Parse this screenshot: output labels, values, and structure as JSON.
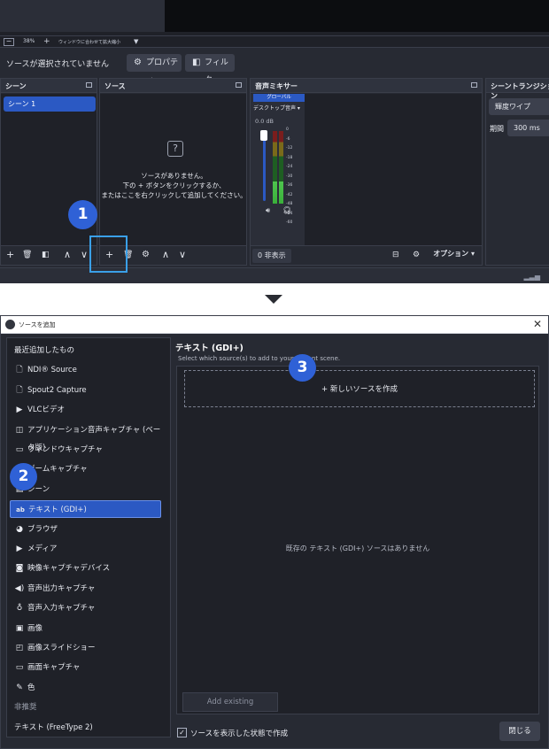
{
  "obs": {
    "zoom": {
      "minus": "−",
      "percent": "38%",
      "plus": "+",
      "fit_label": "ウィンドウに合わせて拡大縮小",
      "caret": "▼"
    },
    "context_bar": {
      "no_source": "ソースが選択されていません",
      "properties": "プロパティ",
      "filters": "フィルタ",
      "properties_icon": "gear-icon",
      "filters_icon": "filter-icon"
    },
    "docks": {
      "scenes": {
        "title": "シーン",
        "items": [
          "シーン 1"
        ]
      },
      "sources": {
        "title": "ソース",
        "empty_icon": "?",
        "empty_text": [
          "ソースがありません。",
          "下の + ボタンをクリックするか、",
          "またはここを右クリックして追加してください。"
        ]
      },
      "mixer": {
        "title": "音声ミキサー",
        "global_label": "グローバル",
        "device": "デスクトップ音声",
        "db": "0.0 dB",
        "ticks": [
          "0",
          "-6",
          "-12",
          "-18",
          "-24",
          "-30",
          "-36",
          "-42",
          "-48",
          "-54",
          "-60"
        ],
        "level": 0.3,
        "hidden_count": "0 非表示",
        "options": "オプション"
      },
      "transitions": {
        "title": "シーントランジション",
        "type": "輝度ワイプ",
        "duration_label": "期間",
        "duration": "300 ms"
      }
    },
    "footer_icons": {
      "add": "+",
      "remove": "🗑",
      "filter": "◧",
      "up": "∧",
      "down": "∨",
      "gear": "⚙"
    },
    "badge": "1"
  },
  "dialog": {
    "title": "ソースを追加",
    "close": "✕",
    "list": [
      {
        "label": "最近追加したもの",
        "icon": ""
      },
      {
        "label": "NDI® Source",
        "icon": "file-icon"
      },
      {
        "label": "Spout2 Capture",
        "icon": "file-icon"
      },
      {
        "label": "VLCビデオ",
        "icon": "play-icon"
      },
      {
        "label": "アプリケーション音声キャプチャ (ベータ版)",
        "icon": "app-audio-icon"
      },
      {
        "label": "ウィンドウキャプチャ",
        "icon": "window-icon"
      },
      {
        "label": "ゲームキャプチャ",
        "icon": "gamepad-icon"
      },
      {
        "label": "シーン",
        "icon": "scene-icon"
      },
      {
        "label": "テキスト (GDI+)",
        "icon": "text-icon"
      },
      {
        "label": "ブラウザ",
        "icon": "globe-icon"
      },
      {
        "label": "メディア",
        "icon": "play-icon"
      },
      {
        "label": "映像キャプチャデバイス",
        "icon": "camera-icon"
      },
      {
        "label": "音声出力キャプチャ",
        "icon": "speaker-icon"
      },
      {
        "label": "音声入力キャプチャ",
        "icon": "microphone-icon"
      },
      {
        "label": "画像",
        "icon": "image-icon"
      },
      {
        "label": "画像スライドショー",
        "icon": "slideshow-icon"
      },
      {
        "label": "画面キャプチャ",
        "icon": "monitor-icon"
      },
      {
        "label": "色",
        "icon": "brush-icon"
      },
      {
        "label": "非推奨",
        "icon": ""
      },
      {
        "label": "テキスト (FreeType 2)",
        "icon": ""
      }
    ],
    "selected_index": 8,
    "panel_title": "テキスト (GDI+)",
    "panel_subtitle": "Select which source(s) to add to your current scene.",
    "new_source": "新しいソースを作成",
    "no_existing": "既存の テキスト (GDI+) ソースはありません",
    "add_existing": "Add existing",
    "visible_checkbox_label": "ソースを表示した状態で作成",
    "visible_checked": true,
    "close_button": "閉じる",
    "badges": [
      "2",
      "3"
    ]
  },
  "colors": {
    "accent": "#2b59c3",
    "badge": "#2f61d6",
    "highlight": "#3aa0e8",
    "bg": "#272a33",
    "panel": "#1f2128"
  }
}
